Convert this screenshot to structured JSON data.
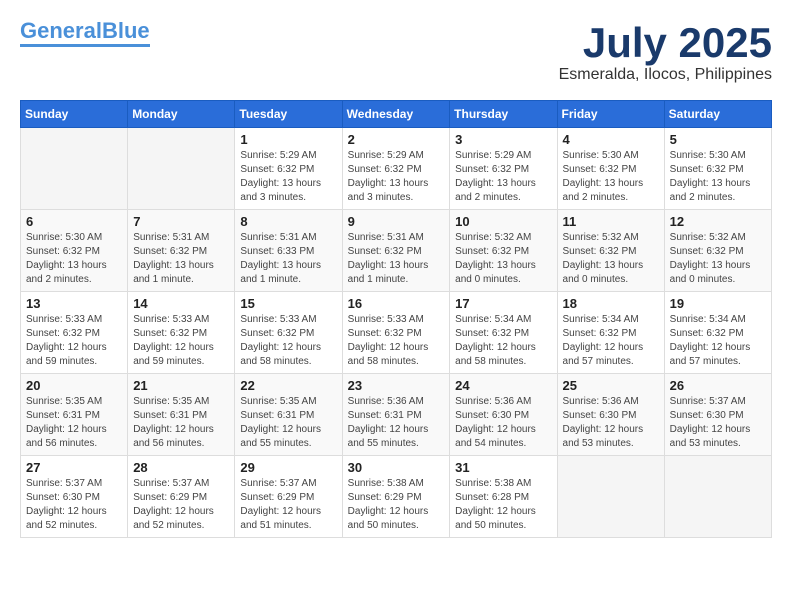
{
  "header": {
    "logo_line1": "General",
    "logo_line2": "Blue",
    "month_title": "July 2025",
    "location": "Esmeralda, Ilocos, Philippines"
  },
  "weekdays": [
    "Sunday",
    "Monday",
    "Tuesday",
    "Wednesday",
    "Thursday",
    "Friday",
    "Saturday"
  ],
  "weeks": [
    [
      {
        "day": "",
        "info": ""
      },
      {
        "day": "",
        "info": ""
      },
      {
        "day": "1",
        "info": "Sunrise: 5:29 AM\nSunset: 6:32 PM\nDaylight: 13 hours and 3 minutes."
      },
      {
        "day": "2",
        "info": "Sunrise: 5:29 AM\nSunset: 6:32 PM\nDaylight: 13 hours and 3 minutes."
      },
      {
        "day": "3",
        "info": "Sunrise: 5:29 AM\nSunset: 6:32 PM\nDaylight: 13 hours and 2 minutes."
      },
      {
        "day": "4",
        "info": "Sunrise: 5:30 AM\nSunset: 6:32 PM\nDaylight: 13 hours and 2 minutes."
      },
      {
        "day": "5",
        "info": "Sunrise: 5:30 AM\nSunset: 6:32 PM\nDaylight: 13 hours and 2 minutes."
      }
    ],
    [
      {
        "day": "6",
        "info": "Sunrise: 5:30 AM\nSunset: 6:32 PM\nDaylight: 13 hours and 2 minutes."
      },
      {
        "day": "7",
        "info": "Sunrise: 5:31 AM\nSunset: 6:32 PM\nDaylight: 13 hours and 1 minute."
      },
      {
        "day": "8",
        "info": "Sunrise: 5:31 AM\nSunset: 6:33 PM\nDaylight: 13 hours and 1 minute."
      },
      {
        "day": "9",
        "info": "Sunrise: 5:31 AM\nSunset: 6:32 PM\nDaylight: 13 hours and 1 minute."
      },
      {
        "day": "10",
        "info": "Sunrise: 5:32 AM\nSunset: 6:32 PM\nDaylight: 13 hours and 0 minutes."
      },
      {
        "day": "11",
        "info": "Sunrise: 5:32 AM\nSunset: 6:32 PM\nDaylight: 13 hours and 0 minutes."
      },
      {
        "day": "12",
        "info": "Sunrise: 5:32 AM\nSunset: 6:32 PM\nDaylight: 13 hours and 0 minutes."
      }
    ],
    [
      {
        "day": "13",
        "info": "Sunrise: 5:33 AM\nSunset: 6:32 PM\nDaylight: 12 hours and 59 minutes."
      },
      {
        "day": "14",
        "info": "Sunrise: 5:33 AM\nSunset: 6:32 PM\nDaylight: 12 hours and 59 minutes."
      },
      {
        "day": "15",
        "info": "Sunrise: 5:33 AM\nSunset: 6:32 PM\nDaylight: 12 hours and 58 minutes."
      },
      {
        "day": "16",
        "info": "Sunrise: 5:33 AM\nSunset: 6:32 PM\nDaylight: 12 hours and 58 minutes."
      },
      {
        "day": "17",
        "info": "Sunrise: 5:34 AM\nSunset: 6:32 PM\nDaylight: 12 hours and 58 minutes."
      },
      {
        "day": "18",
        "info": "Sunrise: 5:34 AM\nSunset: 6:32 PM\nDaylight: 12 hours and 57 minutes."
      },
      {
        "day": "19",
        "info": "Sunrise: 5:34 AM\nSunset: 6:32 PM\nDaylight: 12 hours and 57 minutes."
      }
    ],
    [
      {
        "day": "20",
        "info": "Sunrise: 5:35 AM\nSunset: 6:31 PM\nDaylight: 12 hours and 56 minutes."
      },
      {
        "day": "21",
        "info": "Sunrise: 5:35 AM\nSunset: 6:31 PM\nDaylight: 12 hours and 56 minutes."
      },
      {
        "day": "22",
        "info": "Sunrise: 5:35 AM\nSunset: 6:31 PM\nDaylight: 12 hours and 55 minutes."
      },
      {
        "day": "23",
        "info": "Sunrise: 5:36 AM\nSunset: 6:31 PM\nDaylight: 12 hours and 55 minutes."
      },
      {
        "day": "24",
        "info": "Sunrise: 5:36 AM\nSunset: 6:30 PM\nDaylight: 12 hours and 54 minutes."
      },
      {
        "day": "25",
        "info": "Sunrise: 5:36 AM\nSunset: 6:30 PM\nDaylight: 12 hours and 53 minutes."
      },
      {
        "day": "26",
        "info": "Sunrise: 5:37 AM\nSunset: 6:30 PM\nDaylight: 12 hours and 53 minutes."
      }
    ],
    [
      {
        "day": "27",
        "info": "Sunrise: 5:37 AM\nSunset: 6:30 PM\nDaylight: 12 hours and 52 minutes."
      },
      {
        "day": "28",
        "info": "Sunrise: 5:37 AM\nSunset: 6:29 PM\nDaylight: 12 hours and 52 minutes."
      },
      {
        "day": "29",
        "info": "Sunrise: 5:37 AM\nSunset: 6:29 PM\nDaylight: 12 hours and 51 minutes."
      },
      {
        "day": "30",
        "info": "Sunrise: 5:38 AM\nSunset: 6:29 PM\nDaylight: 12 hours and 50 minutes."
      },
      {
        "day": "31",
        "info": "Sunrise: 5:38 AM\nSunset: 6:28 PM\nDaylight: 12 hours and 50 minutes."
      },
      {
        "day": "",
        "info": ""
      },
      {
        "day": "",
        "info": ""
      }
    ]
  ]
}
